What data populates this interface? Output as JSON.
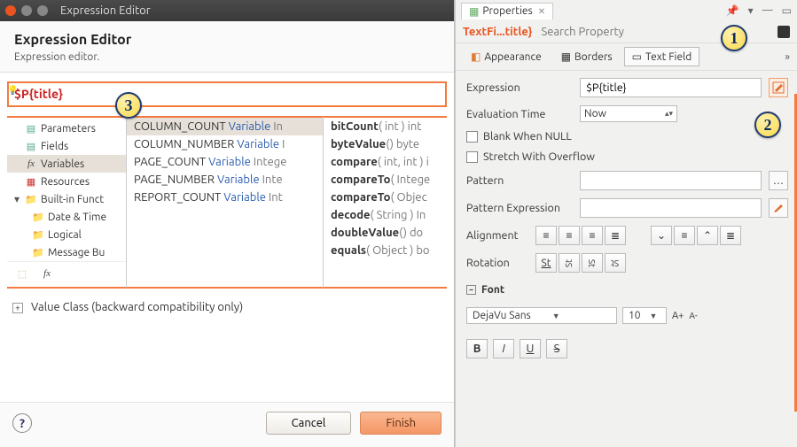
{
  "callouts": {
    "c1": "1",
    "c2": "2",
    "c3": "3"
  },
  "dialog": {
    "window_title": "Expression Editor",
    "heading": "Expression Editor",
    "subheading": "Expression editor.",
    "expression_text": "$P{title}",
    "tree": {
      "parameters": "Parameters",
      "fields": "Fields",
      "variables": "Variables",
      "resources": "Resources",
      "builtin": "Built-in Funct",
      "date_time": "Date & Time",
      "logical": "Logical",
      "message_bu": "Message Bu"
    },
    "variables": [
      {
        "name": "COLUMN_COUNT",
        "kind": "Variable",
        "type": "In"
      },
      {
        "name": "COLUMN_NUMBER",
        "kind": "Variable",
        "type": "I"
      },
      {
        "name": "PAGE_COUNT",
        "kind": "Variable",
        "type": "Intege"
      },
      {
        "name": "PAGE_NUMBER",
        "kind": "Variable",
        "type": "Inte"
      },
      {
        "name": "REPORT_COUNT",
        "kind": "Variable",
        "type": "Int"
      }
    ],
    "functions": [
      {
        "name": "bitCount",
        "sig": "( int )",
        "ret": "int"
      },
      {
        "name": "byteValue",
        "sig": "()",
        "ret": "byte"
      },
      {
        "name": "compare",
        "sig": "( int, int )",
        "ret": "i"
      },
      {
        "name": "compareTo",
        "sig": "( Intege",
        "ret": ""
      },
      {
        "name": "compareTo",
        "sig": "( Objec",
        "ret": ""
      },
      {
        "name": "decode",
        "sig": "( String )",
        "ret": "In"
      },
      {
        "name": "doubleValue",
        "sig": "()",
        "ret": "do"
      },
      {
        "name": "equals",
        "sig": "( Object )",
        "ret": "bo"
      }
    ],
    "value_class_label": "Value Class (backward compatibility only)",
    "cancel": "Cancel",
    "finish": "Finish"
  },
  "panel": {
    "tab": "Properties",
    "breadcrumb": "TextFi...title}",
    "search_placeholder": "Search Property",
    "subtabs": {
      "appearance": "Appearance",
      "borders": "Borders",
      "text_field": "Text Field"
    },
    "expression_label": "Expression",
    "expression_value": "$P{title}",
    "eval_label": "Evaluation Time",
    "eval_value": "Now",
    "blank_label": "Blank When NULL",
    "stretch_label": "Stretch With Overflow",
    "pattern_label": "Pattern",
    "pattern_expr_label": "Pattern Expression",
    "alignment_label": "Alignment",
    "rotation_label": "Rotation",
    "font_section": "Font",
    "font_name": "DejaVu Sans",
    "font_size": "10",
    "a_plus": "A+",
    "a_minus": "A-",
    "bold": "B",
    "italic": "I",
    "underline": "U",
    "strike": "S"
  }
}
